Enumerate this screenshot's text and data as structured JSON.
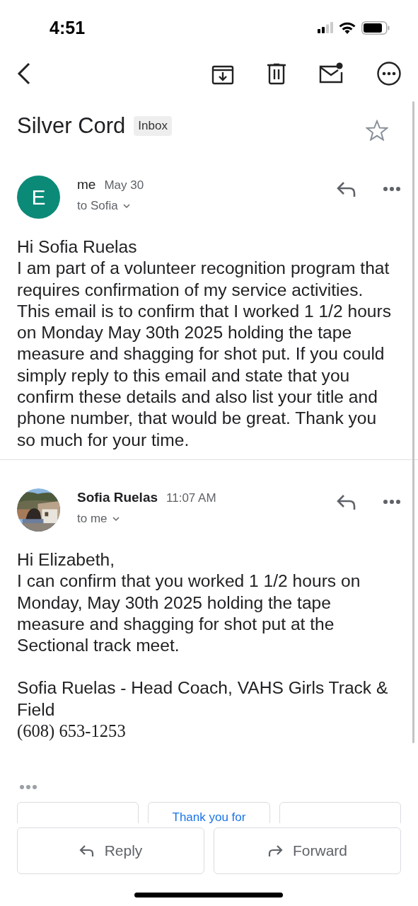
{
  "status_bar": {
    "time": "4:51"
  },
  "subject": {
    "title": "Silver Cord",
    "label": "Inbox",
    "starred": false
  },
  "messages": [
    {
      "sender": "me",
      "date": "May 30",
      "recipient": "to Sofia",
      "avatar": {
        "kind": "letter",
        "letter": "E",
        "color": "#0b8a78"
      },
      "bold_sender": false,
      "body": [
        {
          "kind": "sans",
          "text": "Hi Sofia Ruelas"
        },
        {
          "kind": "sans",
          "text": "I am part of a volunteer recognition program that requires confirmation of my service activities. This email is to confirm that I worked 1 1/2 hours on Monday May 30th 2025 holding the tape measure and shagging for shot put. If you could simply reply to this email and state that you confirm these details and also list your title and phone number, that would be great. Thank you so much for your time."
        }
      ]
    },
    {
      "sender": "Sofia Ruelas",
      "date": "11:07 AM",
      "recipient": "to me",
      "bold_sender": true,
      "body": [
        {
          "kind": "sans",
          "text": "Hi Elizabeth,"
        },
        {
          "kind": "sans",
          "text": "I can confirm that you worked 1 1/2 hours on Monday, May 30th 2025 holding the tape measure and shagging for shot put at the Sectional track meet."
        },
        {
          "kind": "gap"
        },
        {
          "kind": "sans",
          "text": "Sofia Ruelas - Head Coach, VAHS Girls Track & Field"
        },
        {
          "kind": "serif",
          "text": "(608) 653-1253"
        }
      ]
    }
  ],
  "smart_replies": [
    {
      "kind": "blank"
    },
    {
      "kind": "text",
      "label": "Thank you for"
    },
    {
      "kind": "blank"
    }
  ],
  "actions": [
    {
      "kind": "reply",
      "label": "Reply"
    },
    {
      "kind": "forward",
      "label": "Forward"
    }
  ]
}
